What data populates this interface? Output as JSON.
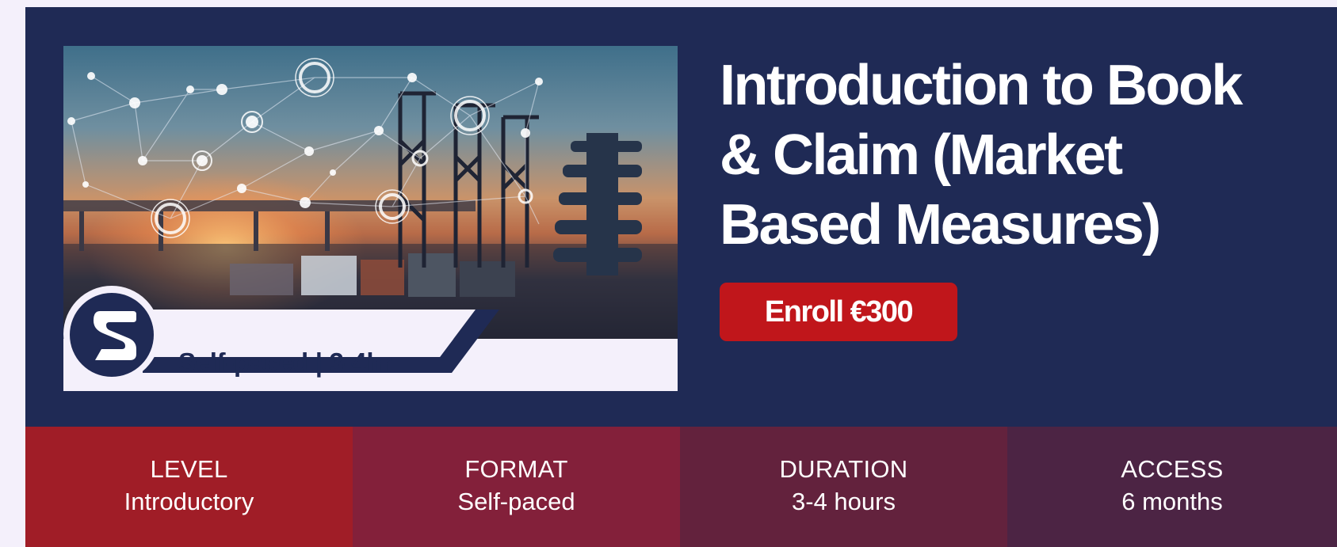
{
  "course": {
    "title": "Introduction to Book & Claim (Market Based Measures)",
    "badge_text": "Self-paced | 3-4hr",
    "enroll_label": "Enroll €300"
  },
  "colors": {
    "hero_bg": "#1f2a55",
    "enroll_button": "#c0161b",
    "page_bg": "#f4f0fb"
  },
  "info": [
    {
      "label": "LEVEL",
      "value": "Introductory",
      "color": "#a01d27"
    },
    {
      "label": "FORMAT",
      "value": "Self-paced",
      "color": "#83203a"
    },
    {
      "label": "DURATION",
      "value": "3-4 hours",
      "color": "#63223d"
    },
    {
      "label": "ACCESS",
      "value": "6 months",
      "color": "#4c2444"
    }
  ],
  "icons": {
    "logo": "company-s-logo-icon",
    "network": "network-nodes-icon"
  }
}
